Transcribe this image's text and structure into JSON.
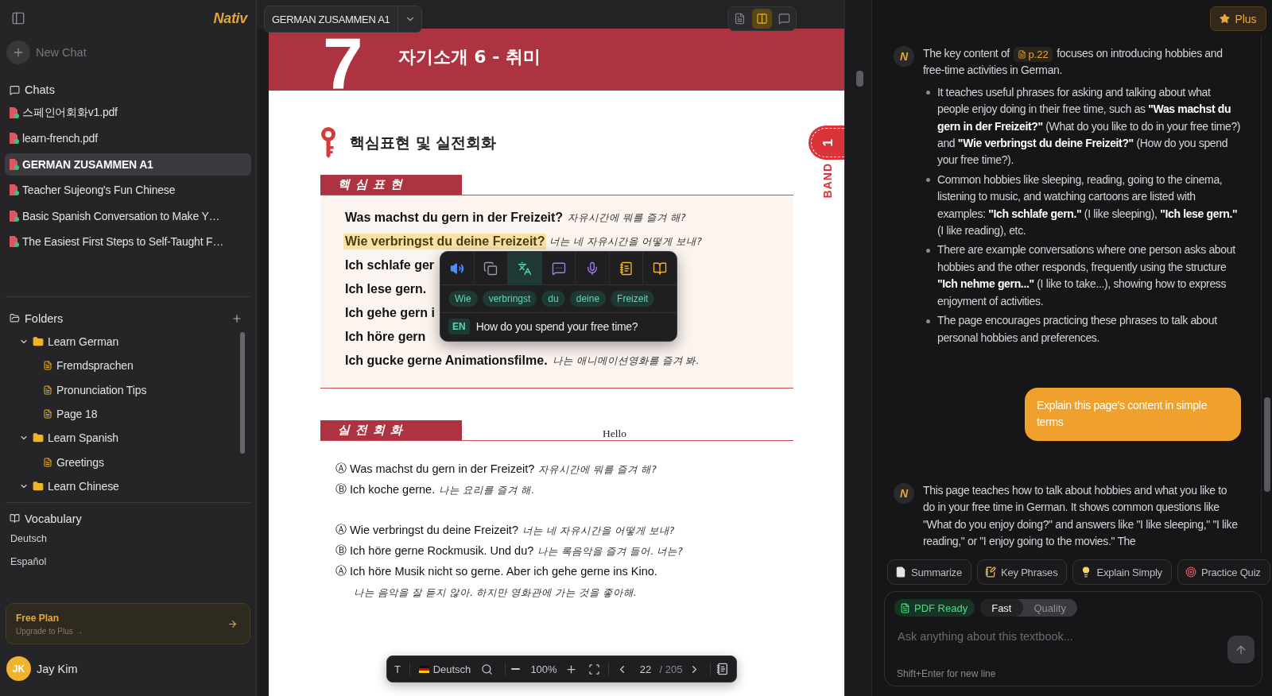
{
  "sidebar": {
    "logo": "Nativ",
    "new_chat": "New Chat",
    "chats_title": "Chats",
    "chats": [
      {
        "title": "스페인어회화v1.pdf",
        "selected": false
      },
      {
        "title": "learn-french.pdf",
        "selected": false
      },
      {
        "title": "GERMAN ZUSAMMEN A1",
        "selected": true
      },
      {
        "title": "Teacher Sujeong's Fun Chinese",
        "selected": false
      },
      {
        "title": "Basic Spanish Conversation to Make Y…",
        "selected": false
      },
      {
        "title": "The Easiest First Steps to Self-Taught F…",
        "selected": false
      }
    ],
    "folders_title": "Folders",
    "folders": [
      {
        "kind": "folder",
        "name": "Learn German",
        "expanded": true,
        "children": [
          {
            "kind": "file",
            "name": "Fremdsprachen"
          },
          {
            "kind": "file",
            "name": "Pronunciation Tips"
          },
          {
            "kind": "file",
            "name": "Page 18"
          }
        ]
      },
      {
        "kind": "folder",
        "name": "Learn Spanish",
        "expanded": true,
        "children": [
          {
            "kind": "file",
            "name": "Greetings"
          }
        ]
      },
      {
        "kind": "folder",
        "name": "Learn Chinese",
        "expanded": true
      }
    ],
    "vocabulary_title": "Vocabulary",
    "vocabulary": [
      "Deutsch",
      "Español"
    ],
    "plan": {
      "title": "Free Plan",
      "subtitle": "Upgrade to Plus →"
    },
    "user": {
      "initials": "JK",
      "name": "Jay Kim"
    }
  },
  "viewer": {
    "document_title": "GERMAN ZUSAMMEN A1",
    "view_modes": [
      {
        "selected": false
      },
      {
        "selected": true
      },
      {
        "selected": false
      }
    ],
    "page": {
      "chapter_number": "7",
      "chapter_title": "자기소개 6 - 취미",
      "section_heading": "핵심표현 및 실전회화",
      "side_tab": {
        "number": "1",
        "label": "BAND"
      },
      "key_expressions": {
        "label": "핵심표현",
        "lines": [
          {
            "german": "Was machst du gern in der Freizeit?",
            "korean": "자유시간에 뭐를 즐겨 해?",
            "highlighted": false
          },
          {
            "german": "Wie verbringst du deine Freizeit?",
            "korean": "너는 네 자유시간을 어떻게 보내?",
            "highlighted": true
          },
          {
            "german": "Ich schlafe ger",
            "highlighted": false
          },
          {
            "german": "Ich lese gern.",
            "highlighted": false
          },
          {
            "german": "Ich gehe gern i",
            "highlighted": false
          },
          {
            "german": "Ich höre gern",
            "highlighted": false
          },
          {
            "german": "Ich gucke gerne Animationsfilme.",
            "korean": "나는 애니메이션영화를 즐겨 봐.",
            "highlighted": false
          }
        ]
      },
      "conversation": {
        "label": "실전회화",
        "note": "Hello",
        "groups": [
          {
            "lines": [
              {
                "speaker": "Ⓐ",
                "german": "Was machst du gern in der Freizeit?",
                "korean": "자유시간에 뭐를 즐겨 해?"
              },
              {
                "speaker": "Ⓑ",
                "german": "Ich koche gerne.",
                "korean": "나는 요리를 즐겨 해."
              }
            ]
          },
          {
            "lines": [
              {
                "speaker": "Ⓐ",
                "german": "Wie verbringst du deine Freizeit?",
                "korean": "너는 네 자유시간을 어떻게 보내?"
              },
              {
                "speaker": "Ⓑ",
                "german": "Ich höre gerne Rockmusik. Und du?",
                "korean": "나는 록음악을 즐겨 들어. 너는?"
              },
              {
                "speaker": "Ⓐ",
                "german": "Ich höre Musik nicht so gerne. Aber ich gehe gerne ins Kino.",
                "korean": "나는 음악을 잘 듣지 않아. 하지만 영화관에 가는 것을 좋아해."
              }
            ]
          }
        ]
      }
    },
    "selection_popup": {
      "tools": [
        {
          "selected": false
        },
        {
          "selected": false
        },
        {
          "selected": true
        },
        {
          "selected": false
        },
        {
          "selected": false
        },
        {
          "selected": false
        },
        {
          "selected": false
        }
      ],
      "words": [
        "Wie",
        "verbringst",
        "du",
        "deine",
        "Freizeit"
      ],
      "language": "EN",
      "translation": "How do you spend your free time?"
    },
    "toolbar": {
      "text_tool": "T",
      "language": "Deutsch",
      "zoom": "100%",
      "page": "22",
      "page_total": "/ 205"
    }
  },
  "chat": {
    "upgrade": "Plus",
    "messages": [
      {
        "kind": "assistant",
        "avatar": "N",
        "text_before": "The key content of",
        "page_ref": "p.22",
        "text_after": "focuses on introducing hobbies and free-time activities in German.",
        "bullets": [
          "It teaches useful phrases for asking and talking about what people enjoy doing in their free time, such as **\"Was machst du gern in der Freizeit?\"** (What do you like to do in your free time?) and **\"Wie verbringst du deine Freizeit?\"** (How do you spend your free time?).",
          "Common hobbies like sleeping, reading, going to the cinema, listening to music, and watching cartoons are listed with examples: **\"Ich schlafe gern.\"** (I like sleeping), **\"Ich lese gern.\"** (I like reading), etc.",
          "There are example conversations where one person asks about hobbies and the other responds, frequently using the structure **\"Ich nehme gern...\"** (I like to take...), showing how to express enjoyment of activities.",
          "The page encourages practicing these phrases to talk about personal hobbies and preferences."
        ]
      },
      {
        "kind": "user",
        "text": "Explain this page's content in simple terms"
      },
      {
        "kind": "assistant",
        "avatar": "N",
        "text": "This page teaches how to talk about hobbies and what you like to do in your free time in German. It shows common questions like \"What do you enjoy doing?\" and answers like \"I like sleeping,\" \"I like reading,\" or \"I enjoy going to the movies.\" The"
      }
    ],
    "quick_actions": [
      "Summarize",
      "Key Phrases",
      "Explain Simply",
      "Practice Quiz"
    ],
    "composer": {
      "status": "PDF Ready",
      "modes": [
        {
          "label": "Fast",
          "selected": true
        },
        {
          "label": "Quality",
          "selected": false
        }
      ],
      "placeholder": "Ask anything about this textbook...",
      "hint": "Shift+Enter for new line"
    }
  }
}
